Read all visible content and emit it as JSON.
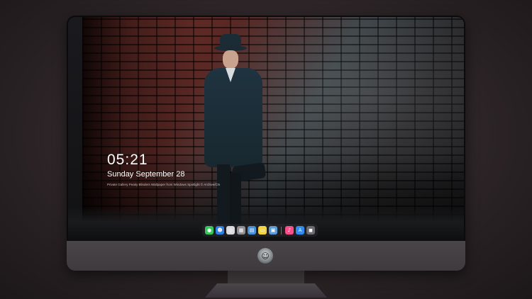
{
  "lock_screen": {
    "time": "05:21",
    "date": "Sunday September  28",
    "caption": "Private Gallery Peaky Blinders Wallpaper from Windows Spotlight  © Archive/CN"
  },
  "dock": {
    "icons": [
      {
        "name": "messages-icon",
        "glyph": "●",
        "color": "#34c759"
      },
      {
        "name": "finder-icon",
        "glyph": "☻",
        "color": "#2f7ee6"
      },
      {
        "name": "safari-icon",
        "glyph": "◎",
        "color": "#d9d9de"
      },
      {
        "name": "launchpad-icon",
        "glyph": "▦",
        "color": "#8e8e93"
      },
      {
        "name": "clapper-icon",
        "glyph": "▤",
        "color": "#4a90d9"
      },
      {
        "name": "notes-icon",
        "glyph": "▭",
        "color": "#f5d442"
      },
      {
        "name": "preview-icon",
        "glyph": "▣",
        "color": "#5b9bd5"
      },
      {
        "name": "music-icon",
        "glyph": "♪",
        "color": "#fa4d8a"
      },
      {
        "name": "app-store-icon",
        "glyph": "A",
        "color": "#2f8cf0"
      },
      {
        "name": "photo-booth-icon",
        "glyph": "◼",
        "color": "#6c6c70"
      }
    ]
  },
  "monitor": {
    "logo_glyph": "☺"
  }
}
